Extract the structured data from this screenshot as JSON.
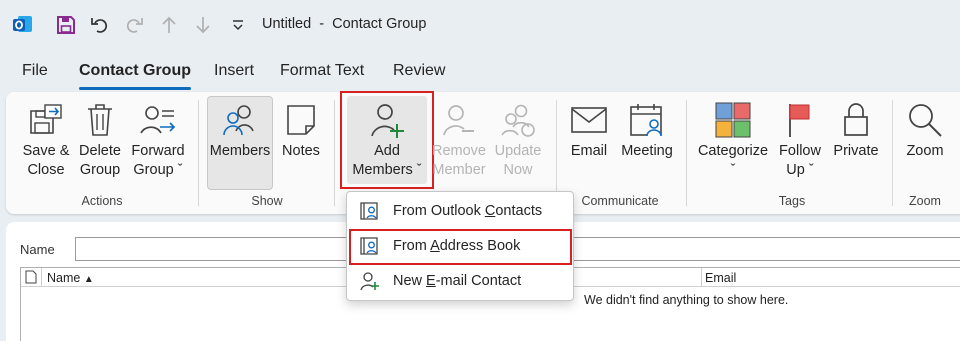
{
  "window": {
    "title": "Untitled  -  Contact Group"
  },
  "quick_access": [
    "outlook-icon",
    "save-icon",
    "undo-icon",
    "redo-icon",
    "previous-item-icon",
    "next-item-icon",
    "customize-toolbar-icon"
  ],
  "menu": {
    "tabs": [
      {
        "label": "File"
      },
      {
        "label": "Contact Group",
        "active": true
      },
      {
        "label": "Insert"
      },
      {
        "label": "Format Text"
      },
      {
        "label": "Review"
      }
    ]
  },
  "ribbon": {
    "actions": {
      "save_close": [
        "Save &",
        "Close"
      ],
      "delete_group": [
        "Delete",
        "Group"
      ],
      "forward_group": [
        "Forward",
        "Group ˇ"
      ],
      "label": "Actions"
    },
    "show": {
      "members": "Members",
      "notes": "Notes",
      "label": "Show"
    },
    "members_grp": {
      "add_members": [
        "Add",
        "Members ˇ"
      ],
      "remove_member": [
        "Remove",
        "Member"
      ],
      "update_now": [
        "Update",
        "Now"
      ]
    },
    "communicate": {
      "email": "Email",
      "meeting": "Meeting",
      "label": "Communicate"
    },
    "tags": {
      "categorize": [
        "Categorize",
        "ˇ"
      ],
      "follow_up": [
        "Follow",
        "Up ˇ"
      ],
      "private": "Private",
      "label": "Tags"
    },
    "zoom": {
      "zoom": "Zoom",
      "label": "Zoom"
    }
  },
  "form": {
    "name_label": "Name",
    "name_value": "",
    "columns": {
      "name": "Name",
      "email": "Email"
    },
    "empty_message": "We didn't find anything to show here."
  },
  "dropdown": {
    "items": [
      {
        "pre": "From Outlook ",
        "key": "C",
        "post": "ontacts"
      },
      {
        "pre": "From ",
        "key": "A",
        "post": "ddress Book",
        "highlighted": true
      },
      {
        "pre": "New ",
        "key": "E",
        "post": "-mail Contact"
      }
    ]
  },
  "colors": {
    "accent": "#0f6cbd",
    "highlight_border": "#d92020",
    "save_purple": "#8a2b8f"
  }
}
